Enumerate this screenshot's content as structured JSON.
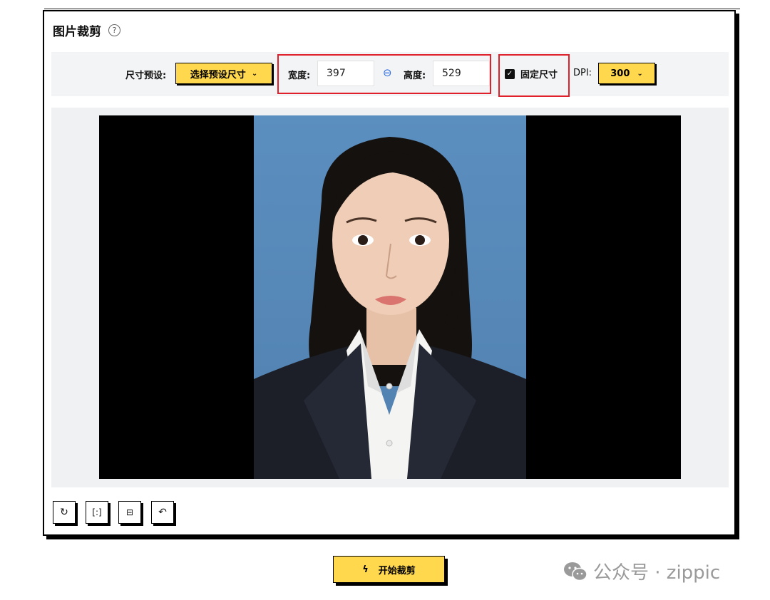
{
  "card": {
    "title": "图片裁剪",
    "help_icon": "question-circle-icon"
  },
  "toolbar": {
    "size_preset_label": "尺寸预设:",
    "size_preset_button": "选择预设尺寸",
    "width_label": "宽度:",
    "width_value": "397",
    "height_label": "高度:",
    "height_value": "529",
    "fixed_size_label": "固定尺寸",
    "fixed_size_checked": true,
    "dpi_label": "DPI:",
    "dpi_value": "300"
  },
  "tools": [
    {
      "name": "rotate",
      "icon": "rotate-icon"
    },
    {
      "name": "flip-horizontal",
      "icon": "flip-horizontal-icon"
    },
    {
      "name": "flip-vertical",
      "icon": "flip-vertical-icon"
    },
    {
      "name": "undo",
      "icon": "undo-icon"
    }
  ],
  "start_button": {
    "label": "开始裁剪",
    "icon": "lightning-icon"
  },
  "watermark": {
    "text": "公众号 · zippic",
    "icon": "wechat-icon"
  },
  "colors": {
    "accent": "#ffd84d",
    "highlight": "#e0202a",
    "border": "#000000",
    "photo_bg": "#5b8fbf"
  }
}
